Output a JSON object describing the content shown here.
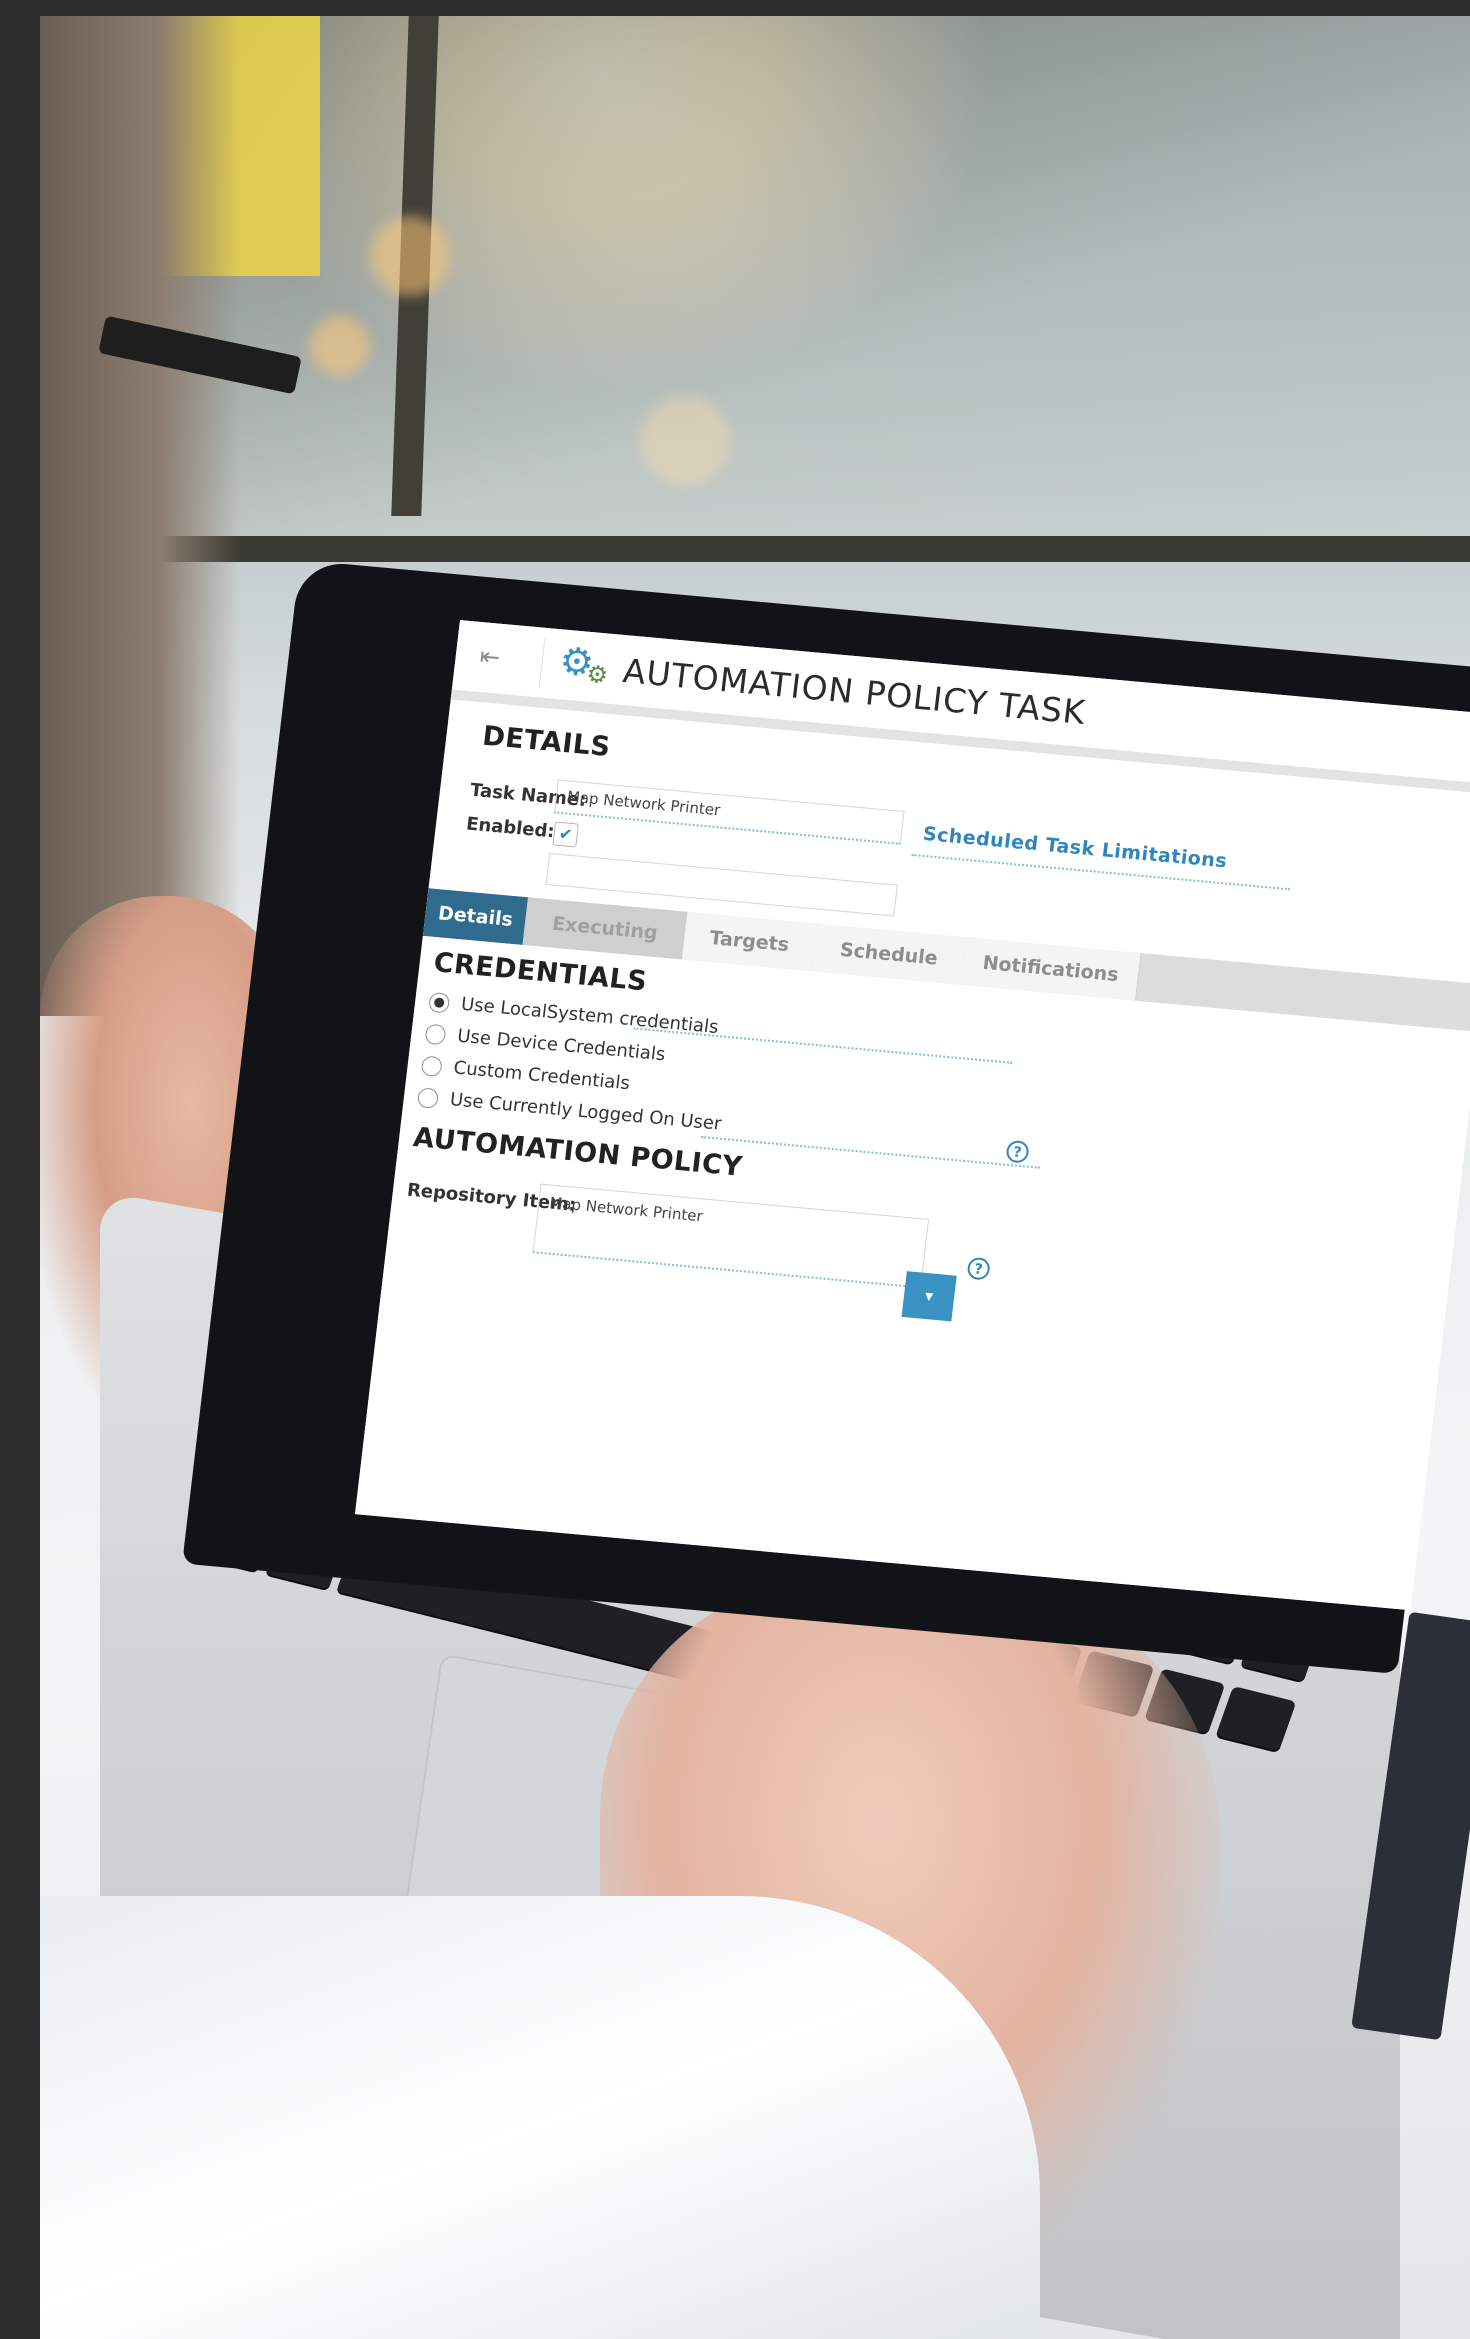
{
  "app": {
    "title": "AUTOMATION POLICY TASK",
    "menu_icon": "menu-collapse-icon",
    "brand_icon": "gears-icon"
  },
  "details": {
    "title": "DETAILS",
    "task_name_label": "Task Name:",
    "task_name_value": "Map Network Printer",
    "enabled_label": "Enabled:",
    "enabled_checked": true,
    "scheduled_link": "Scheduled Task Limitations"
  },
  "tabs": [
    {
      "label": "Details",
      "active": true
    },
    {
      "label": "Executing Devices",
      "active": false
    },
    {
      "label": "Targets",
      "active": false
    },
    {
      "label": "Schedule",
      "active": false
    },
    {
      "label": "Notifications",
      "active": false
    }
  ],
  "credentials": {
    "title": "CREDENTIALS",
    "options": [
      {
        "label": "Use LocalSystem credentials",
        "checked": true
      },
      {
        "label": "Use Device Credentials",
        "checked": false
      },
      {
        "label": "Custom Credentials",
        "checked": false
      },
      {
        "label": "Use Currently Logged On User",
        "checked": false
      }
    ]
  },
  "automation_policy": {
    "title": "AUTOMATION POLICY",
    "repository_label": "Repository Item:",
    "repository_value": "Map Network Printer"
  },
  "colors": {
    "accent": "#2f86bd",
    "tab_active": "#2e6b8e",
    "dropdown": "#3a92c3"
  }
}
